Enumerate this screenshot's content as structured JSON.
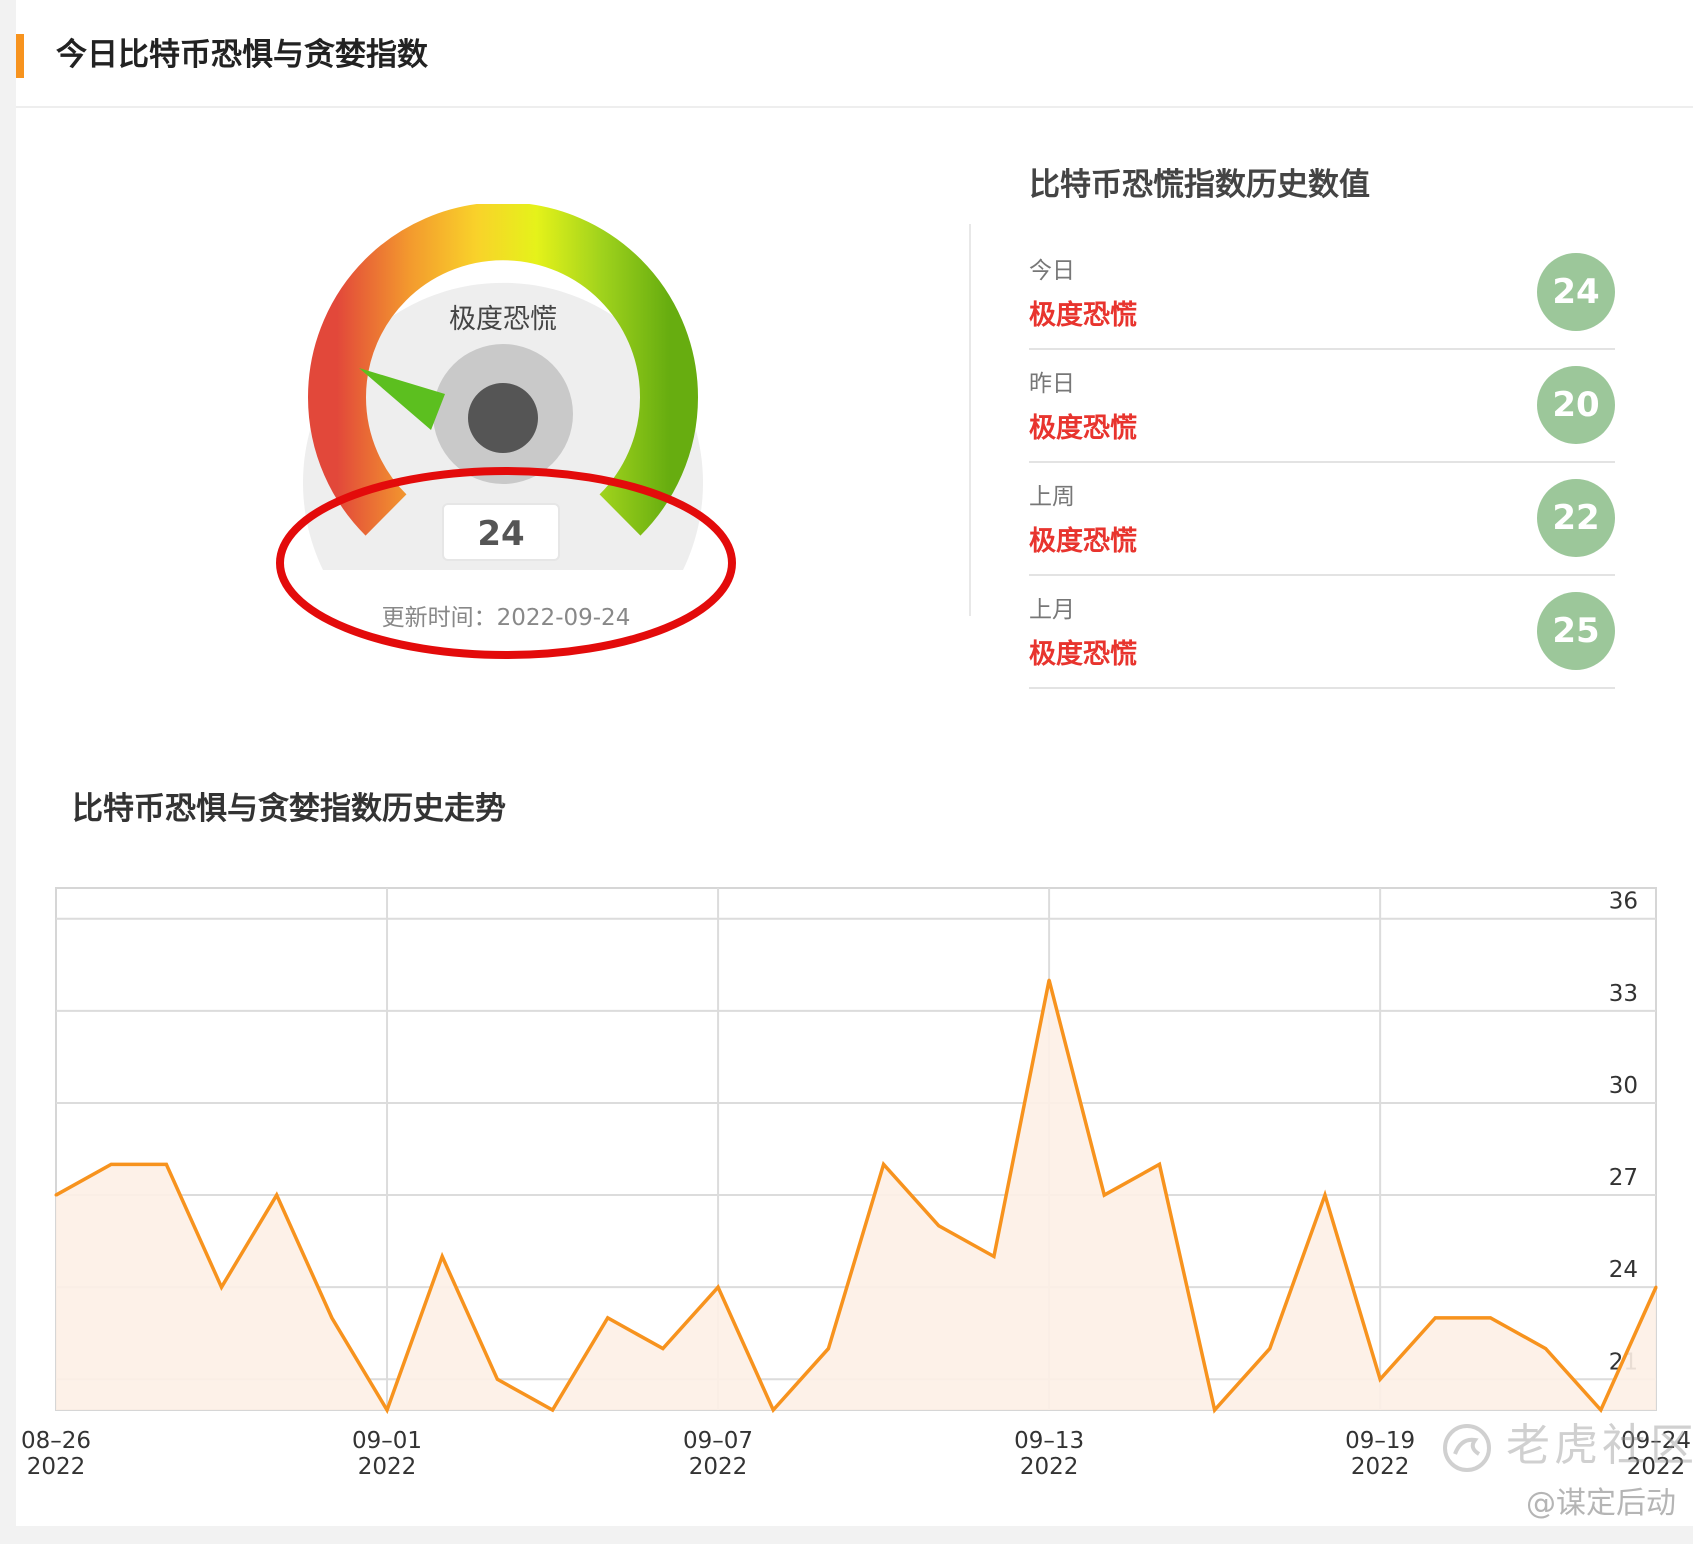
{
  "header": {
    "title": "今日比特币恐惧与贪婪指数"
  },
  "gauge": {
    "label": "极度恐慌",
    "value": "24",
    "value_num": 24,
    "update_time": "更新时间：2022-09-24"
  },
  "history": {
    "title": "比特币恐慌指数历史数值",
    "rows": [
      {
        "period": "今日",
        "status": "极度恐慌",
        "value": "24"
      },
      {
        "period": "昨日",
        "status": "极度恐慌",
        "value": "20"
      },
      {
        "period": "上周",
        "status": "极度恐慌",
        "value": "22"
      },
      {
        "period": "上月",
        "status": "极度恐慌",
        "value": "25"
      }
    ]
  },
  "trend": {
    "title": "比特币恐惧与贪婪指数历史走势"
  },
  "watermark": {
    "brand": "老虎社区",
    "user": "@谋定后动"
  },
  "colors": {
    "accent": "#f7931e",
    "status_red": "#e8342e",
    "badge_green": "#9cc79a"
  },
  "chart_data": {
    "type": "area",
    "x": [
      "08-26",
      "08-27",
      "08-28",
      "08-29",
      "08-30",
      "08-31",
      "09-01",
      "09-02",
      "09-03",
      "09-04",
      "09-05",
      "09-06",
      "09-07",
      "09-08",
      "09-09",
      "09-10",
      "09-11",
      "09-12",
      "09-13",
      "09-14",
      "09-15",
      "09-16",
      "09-17",
      "09-18",
      "09-19",
      "09-20",
      "09-21",
      "09-22",
      "09-23",
      "09-24"
    ],
    "series": [
      {
        "values": [
          27,
          28,
          28,
          24,
          27,
          23,
          20,
          25,
          21,
          20,
          23,
          22,
          24,
          20,
          22,
          28,
          26,
          25,
          34,
          27,
          28,
          20,
          22,
          27,
          21,
          23,
          23,
          22,
          20,
          24
        ]
      }
    ],
    "xticks": [
      {
        "x": "08-26",
        "line1": "08–26",
        "line2": "2022"
      },
      {
        "x": "09-01",
        "line1": "09–01",
        "line2": "2022"
      },
      {
        "x": "09-07",
        "line1": "09–07",
        "line2": "2022"
      },
      {
        "x": "09-13",
        "line1": "09–13",
        "line2": "2022"
      },
      {
        "x": "09-19",
        "line1": "09–19",
        "line2": "2022"
      },
      {
        "x": "09-24",
        "line1": "09–24",
        "line2": "2022"
      }
    ],
    "yticks": [
      21,
      24,
      27,
      30,
      33,
      36
    ],
    "ylim": [
      20,
      37
    ],
    "grid": true,
    "line_color": "#f7931e",
    "fill_color": "#fdf0e6"
  }
}
